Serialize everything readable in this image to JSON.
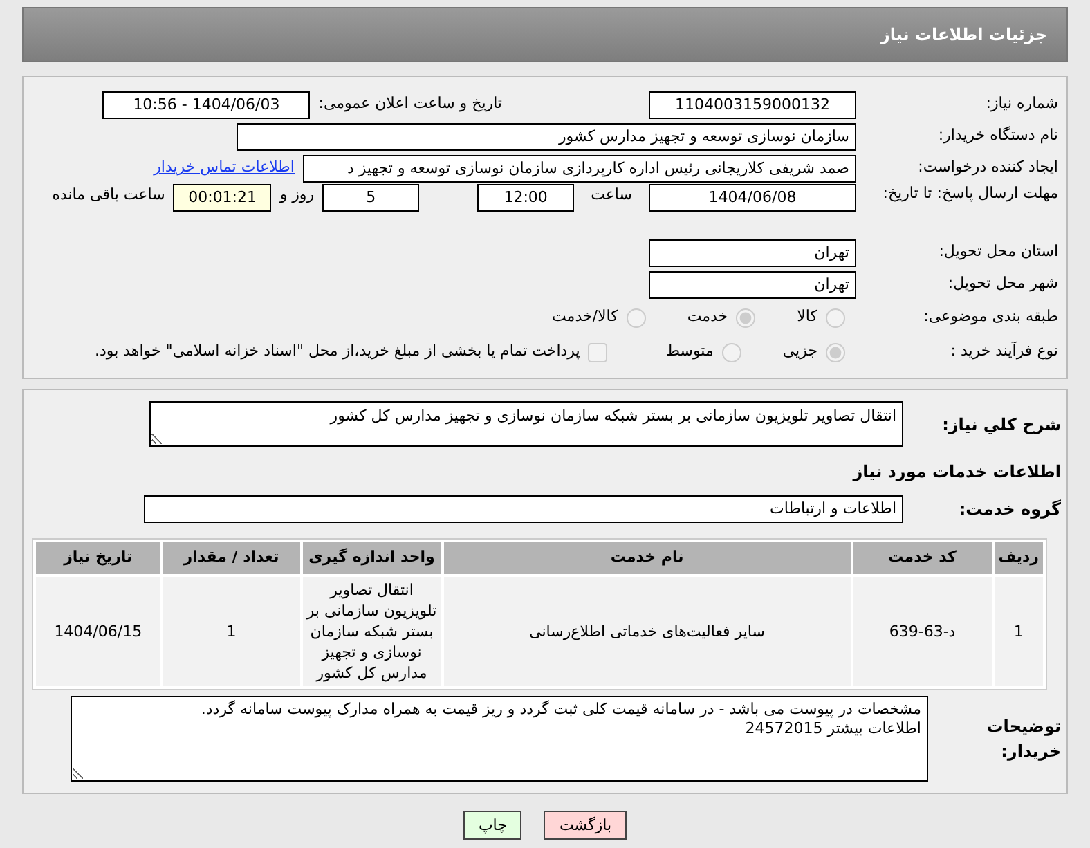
{
  "header": {
    "title": "جزئیات اطلاعات نیاز"
  },
  "need_info": {
    "need_number": {
      "label": "شماره نیاز:",
      "value": "1104003159000132"
    },
    "announce": {
      "label": "تاریخ و ساعت اعلان عمومی:",
      "value": "1404/06/03 - 10:56"
    },
    "buyer_org": {
      "label": "نام دستگاه خریدار:",
      "value": "سازمان نوسازی  توسعه و تجهیز مدارس کشور"
    },
    "requester": {
      "label": "ایجاد کننده درخواست:",
      "value": "صمد شریفی کلاریجانی رئیس اداره کارپردازی سازمان نوسازی  توسعه و تجهیز د",
      "link": "اطلاعات تماس خریدار"
    },
    "deadline": {
      "label": "مهلت ارسال پاسخ: تا تاریخ:",
      "date": "1404/06/08",
      "time_label": "ساعت",
      "time": "12:00",
      "days": "5",
      "days_label": "روز و",
      "remaining": "00:01:21",
      "remaining_label": "ساعت باقی مانده"
    },
    "province": {
      "label": "استان محل تحویل:",
      "value": "تهران"
    },
    "city": {
      "label": "شهر محل تحویل:",
      "value": "تهران"
    },
    "category": {
      "label": "طبقه بندی موضوعی:",
      "options": [
        {
          "label": "کالا",
          "selected": false
        },
        {
          "label": "خدمت",
          "selected": true
        },
        {
          "label": "کالا/خدمت",
          "selected": false
        }
      ]
    },
    "process": {
      "label": "نوع فرآیند خرید :",
      "options": [
        {
          "label": "جزیی",
          "selected": true
        },
        {
          "label": "متوسط",
          "selected": false
        }
      ],
      "checkbox": {
        "checked": false,
        "text": "پرداخت تمام یا بخشی از مبلغ خرید،از محل \"اسناد خزانه اسلامی\" خواهد بود."
      }
    }
  },
  "services": {
    "description": {
      "label": "شرح کلي نياز:",
      "value": "انتقال تصاویر تلویزیون سازمانی بر بستر شبکه سازمان نوسازی و تجهیز مدارس کل کشور"
    },
    "heading": "اطلاعات خدمات مورد نیاز",
    "group": {
      "label": "گروه خدمت:",
      "value": "اطلاعات و ارتباطات"
    },
    "table": {
      "columns": [
        "ردیف",
        "کد خدمت",
        "نام خدمت",
        "واحد اندازه گیری",
        "تعداد / مقدار",
        "تاریخ نیاز"
      ],
      "rows": [
        [
          "1",
          "د-63-639",
          "سایر فعالیت‌های خدماتی اطلاع‌رسانی",
          "انتقال تصاویر تلویزیون سازمانی بر بستر شبکه سازمان نوسازی و تجهیز مدارس کل کشور",
          "1",
          "1404/06/15"
        ]
      ]
    },
    "buyer_notes": {
      "label": "توضیحات خریدار:",
      "lines": [
        "مشخصات در پیوست می باشد - در سامانه قیمت کلی ثبت گردد و ریز قیمت به همراه مدارک پیوست سامانه گردد.",
        "اطلاعات بیشتر 24572015"
      ]
    }
  },
  "buttons": [
    {
      "label": "بازگشت",
      "kind": "back"
    },
    {
      "label": "چاپ",
      "kind": "print"
    }
  ]
}
